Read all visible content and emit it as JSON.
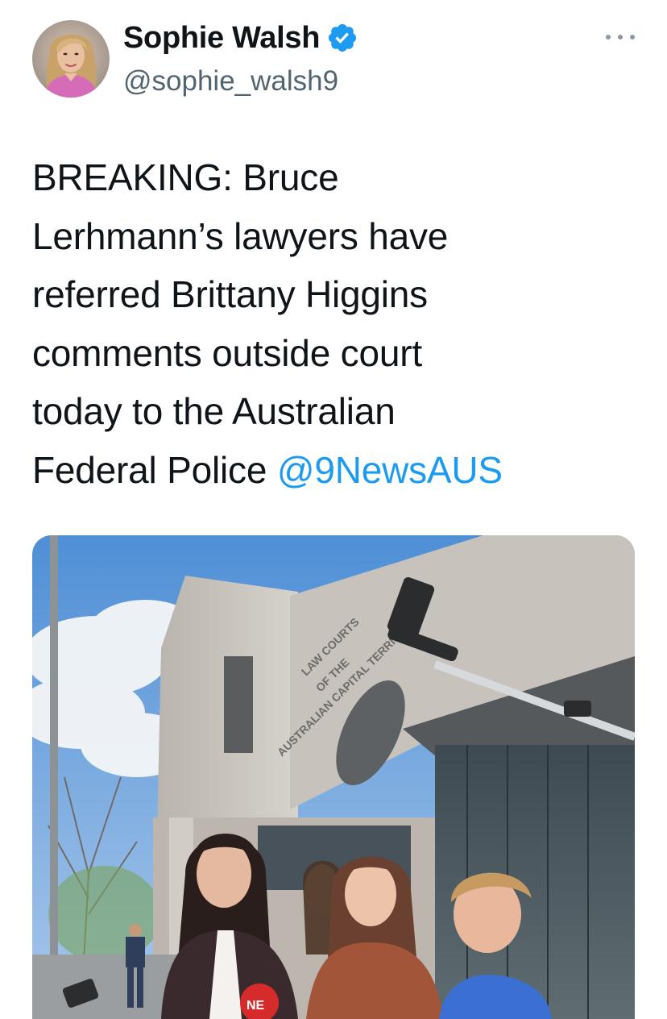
{
  "author": {
    "display_name": "Sophie Walsh",
    "handle": "@sophie_walsh9",
    "verified": true,
    "avatar_icon": "profile-photo"
  },
  "menu": {
    "icon": "more-horizontal-icon"
  },
  "tweet": {
    "lines": [
      "BREAKING: Bruce",
      "Lerhmann’s lawyers have",
      "referred Brittany Higgins",
      "comments outside court",
      "today to the Australian",
      "Federal Police "
    ],
    "mention": "@9NewsAUS"
  },
  "media": {
    "building_sign_lines": [
      "LAW COURTS",
      "OF THE",
      "AUSTRALIAN CAPITAL TERRITORY"
    ],
    "camera_logo_text": "NE"
  },
  "colors": {
    "link": "#1d9bf0",
    "verified_badge": "#1d9bf0",
    "text": "#0f1419",
    "secondary_text": "#536471"
  }
}
